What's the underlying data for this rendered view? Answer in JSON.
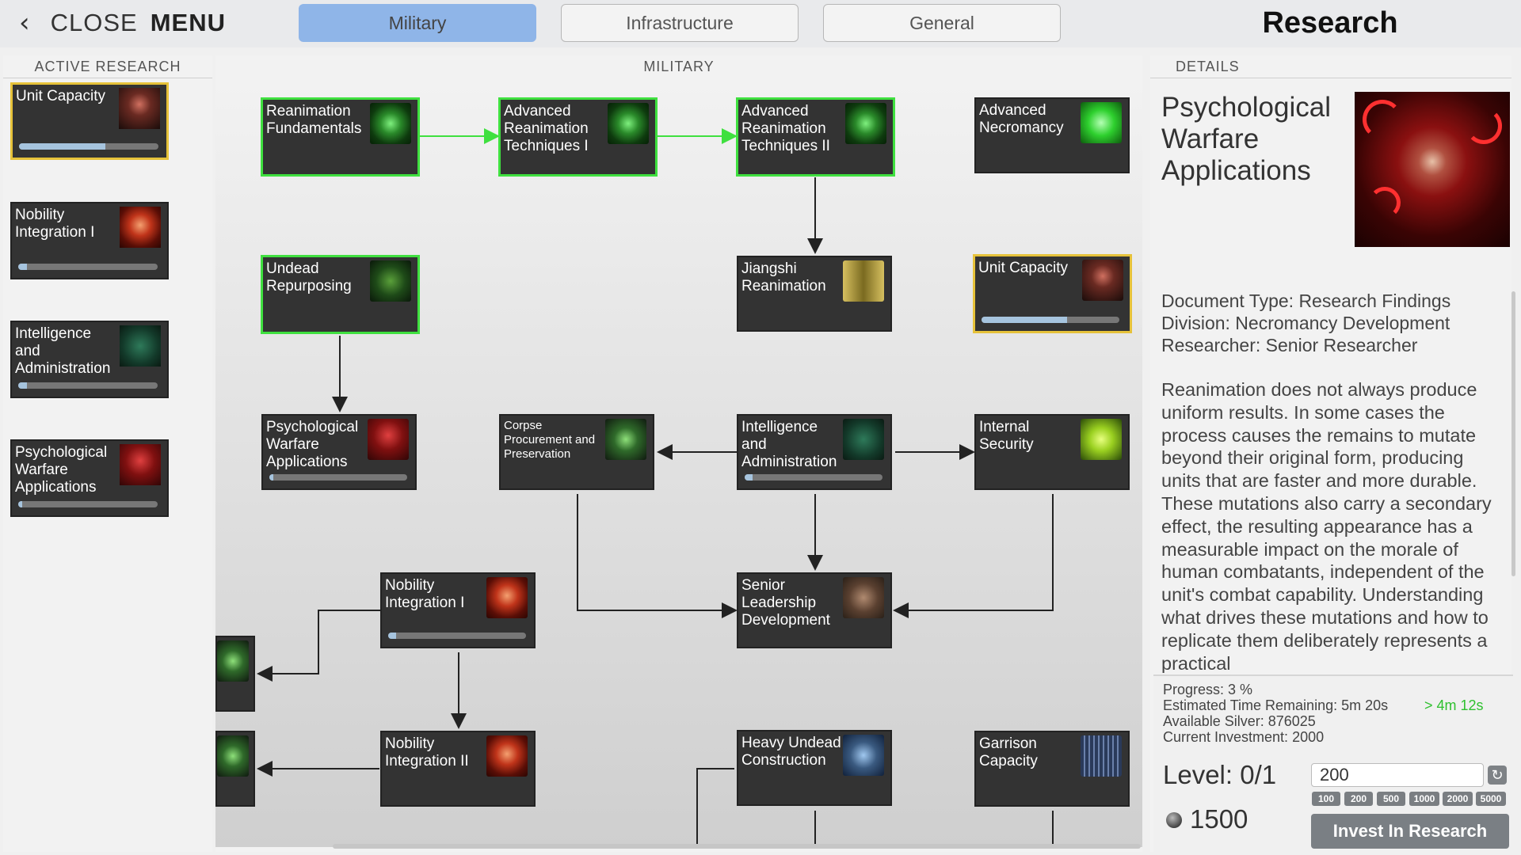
{
  "topbar": {
    "close_label": "CLOSE",
    "menu_label": "MENU",
    "tabs": [
      {
        "label": "Military",
        "active": true
      },
      {
        "label": "Infrastructure",
        "active": false
      },
      {
        "label": "General",
        "active": false
      }
    ],
    "title": "Research"
  },
  "left_panel": {
    "header": "ACTIVE RESEARCH",
    "items": [
      {
        "label": "Unit Capacity",
        "progress": 0.62,
        "icon": "silhouette-icon",
        "active": true
      },
      {
        "label": "Nobility Integration I",
        "progress": 0.06,
        "icon": "noble-icon",
        "active": false
      },
      {
        "label": "Intelligence and Administration",
        "progress": 0.06,
        "icon": "brain-icon",
        "active": false
      },
      {
        "label": "Psychological Warfare Applications",
        "progress": 0.03,
        "icon": "psych-icon",
        "active": false
      }
    ]
  },
  "tree": {
    "header": "MILITARY",
    "nodes": {
      "reanimation_fundamentals": {
        "label": "Reanimation Fundamentals",
        "icon": "reanimation-icon",
        "state": "done"
      },
      "adv_reanimation_1": {
        "label": "Advanced Reanimation Techniques I",
        "icon": "reanimation-icon",
        "state": "done"
      },
      "adv_reanimation_2": {
        "label": "Advanced Reanimation Techniques II",
        "icon": "reanimation-icon",
        "state": "done"
      },
      "adv_necromancy": {
        "label": "Advanced Necromancy",
        "icon": "book-icon",
        "state": "locked"
      },
      "undead_repurposing": {
        "label": "Undead Repurposing",
        "icon": "moss-icon",
        "state": "done"
      },
      "jiangshi": {
        "label": "Jiangshi Reanimation",
        "icon": "scroll-icon",
        "state": "locked"
      },
      "unit_capacity": {
        "label": "Unit Capacity",
        "icon": "silhouette-icon",
        "state": "active",
        "progress": 0.62
      },
      "psych_warfare": {
        "label": "Psychological Warfare Applications",
        "icon": "psych-icon",
        "state": "in-progress",
        "progress": 0.03
      },
      "corpse": {
        "label": "Corpse Procurement and Preservation",
        "icon": "corpse-icon",
        "state": "locked"
      },
      "intelligence": {
        "label": "Intelligence and Administration",
        "icon": "brain-icon",
        "state": "in-progress",
        "progress": 0.06
      },
      "internal_security": {
        "label": "Internal Security",
        "icon": "eye-icon",
        "state": "locked"
      },
      "nobility_1": {
        "label": "Nobility Integration I",
        "icon": "noble-icon",
        "state": "in-progress",
        "progress": 0.06
      },
      "senior_leadership": {
        "label": "Senior Leadership Development",
        "icon": "seat-icon",
        "state": "locked"
      },
      "nobility_2": {
        "label": "Nobility Integration II",
        "icon": "noble-icon",
        "state": "locked"
      },
      "heavy_undead": {
        "label": "Heavy Undead Construction",
        "icon": "helmet-icon",
        "state": "locked"
      },
      "garrison": {
        "label": "Garrison Capacity",
        "icon": "gate-icon",
        "state": "locked"
      }
    }
  },
  "details": {
    "header": "DETAILS",
    "title": "Psychological Warfare Applications",
    "meta": [
      "Document Type: Research Findings",
      "Division: Necromancy Development",
      "Researcher: Senior Researcher"
    ],
    "description": "Reanimation does not always produce uniform results. In some cases the process causes the remains to mutate beyond their original form, producing units that are faster and more durable. These mutations also carry a secondary effect, the resulting appearance has a measurable impact on the morale of human combatants, independent of the unit's combat capability. Understanding what drives these mutations and how to replicate them deliberately represents a practical",
    "progress": "Progress: 3 %",
    "eta": "Estimated Time Remaining: 5m 20s",
    "eta_bonus": "> 4m 12s",
    "silver": "Available Silver: 876025",
    "investment": "Current Investment: 2000",
    "level": "Level: 0/1",
    "amount_value": "200",
    "quick_amounts": [
      "100",
      "200",
      "500",
      "1000",
      "2000",
      "5000"
    ],
    "cost": "1500",
    "invest_label": "Invest In Research"
  },
  "colors": {
    "accent": "#8fb5e8",
    "done": "#3fe03f",
    "active": "#e6c23a",
    "node_bg": "#333333"
  }
}
